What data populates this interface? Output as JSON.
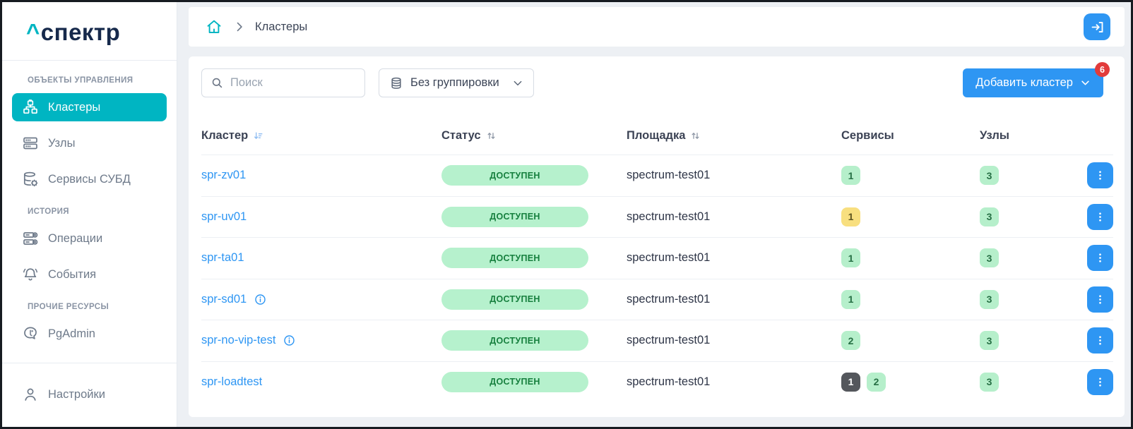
{
  "app": {
    "logo_caret": "^",
    "logo_text": "спектр"
  },
  "sidebar": {
    "sections": [
      {
        "label": "ОБЪЕКТЫ УПРАВЛЕНИЯ",
        "items": [
          {
            "id": "clusters",
            "label": "Кластеры",
            "icon": "cluster-icon",
            "active": true
          },
          {
            "id": "nodes",
            "label": "Узлы",
            "icon": "server-icon",
            "active": false
          },
          {
            "id": "db-services",
            "label": "Сервисы СУБД",
            "icon": "database-gear-icon",
            "active": false
          }
        ]
      },
      {
        "label": "ИСТОРИЯ",
        "items": [
          {
            "id": "operations",
            "label": "Операции",
            "icon": "operations-icon",
            "active": false
          },
          {
            "id": "events",
            "label": "События",
            "icon": "bell-icon",
            "active": false
          }
        ]
      },
      {
        "label": "ПРОЧИЕ РЕСУРСЫ",
        "items": [
          {
            "id": "pgadmin",
            "label": "PgAdmin",
            "icon": "pgadmin-elephant-icon",
            "active": false
          }
        ]
      }
    ],
    "footer_item": {
      "id": "settings",
      "label": "Настройки",
      "icon": "user-icon"
    }
  },
  "breadcrumb": {
    "current": "Кластеры"
  },
  "toolbar": {
    "search_placeholder": "Поиск",
    "grouping_label": "Без группировки",
    "add_button_label": "Добавить кластер",
    "add_button_badge": "6"
  },
  "table": {
    "columns": [
      {
        "id": "cluster",
        "label": "Кластер",
        "sort": "asc"
      },
      {
        "id": "status",
        "label": "Статус",
        "sort": "both"
      },
      {
        "id": "site",
        "label": "Площадка",
        "sort": "both"
      },
      {
        "id": "services",
        "label": "Сервисы",
        "sort": null
      },
      {
        "id": "nodes",
        "label": "Узлы",
        "sort": null
      }
    ],
    "rows": [
      {
        "name": "spr-zv01",
        "info": false,
        "status": "ДОСТУПЕН",
        "site": "spectrum-test01",
        "services": [
          {
            "value": "1",
            "type": "green"
          }
        ],
        "nodes": "3"
      },
      {
        "name": "spr-uv01",
        "info": false,
        "status": "ДОСТУПЕН",
        "site": "spectrum-test01",
        "services": [
          {
            "value": "1",
            "type": "yellow"
          }
        ],
        "nodes": "3"
      },
      {
        "name": "spr-ta01",
        "info": false,
        "status": "ДОСТУПЕН",
        "site": "spectrum-test01",
        "services": [
          {
            "value": "1",
            "type": "green"
          }
        ],
        "nodes": "3"
      },
      {
        "name": "spr-sd01",
        "info": true,
        "status": "ДОСТУПЕН",
        "site": "spectrum-test01",
        "services": [
          {
            "value": "1",
            "type": "green"
          }
        ],
        "nodes": "3"
      },
      {
        "name": "spr-no-vip-test",
        "info": true,
        "status": "ДОСТУПЕН",
        "site": "spectrum-test01",
        "services": [
          {
            "value": "2",
            "type": "green"
          }
        ],
        "nodes": "3"
      },
      {
        "name": "spr-loadtest",
        "info": false,
        "status": "ДОСТУПЕН",
        "site": "spectrum-test01",
        "services": [
          {
            "value": "1",
            "type": "dark"
          },
          {
            "value": "2",
            "type": "green"
          }
        ],
        "nodes": "3"
      }
    ]
  },
  "colors": {
    "accent_teal": "#00b5c2",
    "accent_blue": "#2e96f3",
    "logo_navy": "#16294b",
    "status_green_bg": "#b6f1cd",
    "status_green_text": "#157f3d",
    "chip_yellow_bg": "#f8df7f",
    "chip_dark_bg": "#54575c",
    "badge_red": "#e23b3b"
  }
}
